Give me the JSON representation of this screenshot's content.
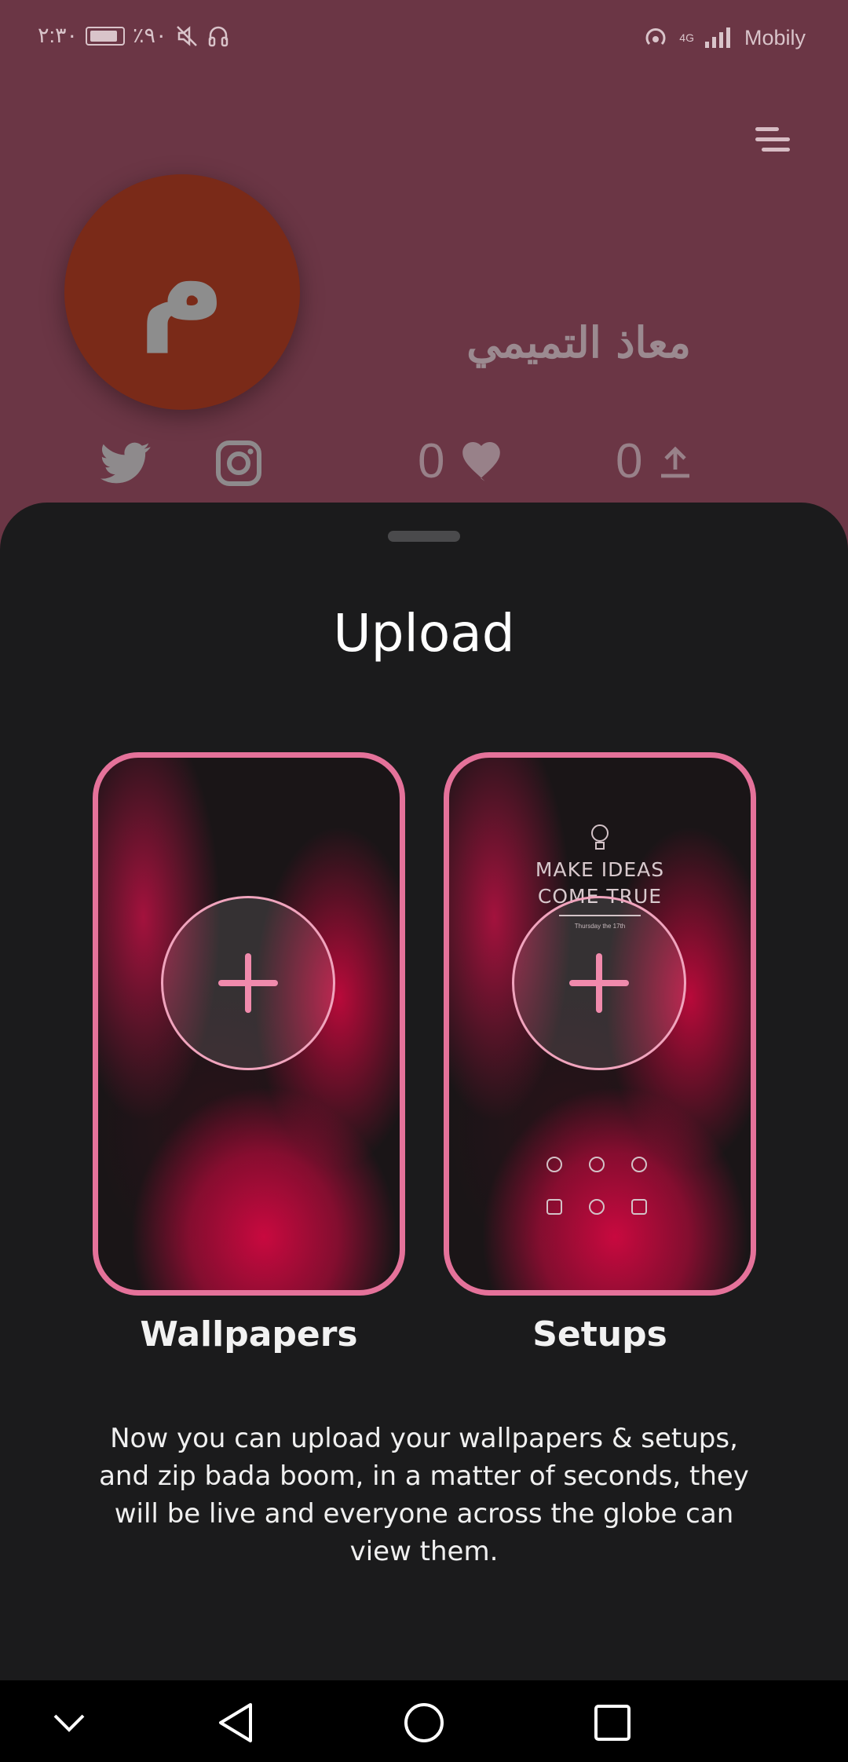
{
  "status_bar": {
    "time": "٢:٣٠",
    "battery": "٪٩٠",
    "carrier": "Mobily",
    "network": "4G"
  },
  "profile": {
    "avatar_letter": "م",
    "name": "معاذ التميمي",
    "likes_count": "0",
    "uploads_count": "0",
    "social_links": [
      "twitter-icon",
      "instagram-icon"
    ]
  },
  "sheet": {
    "title": "Upload",
    "cards": [
      {
        "label": "Wallpapers"
      },
      {
        "label": "Setups",
        "preview_line1": "MAKE IDEAS",
        "preview_line2": "COME TRUE",
        "preview_date": "Thursday the 17th"
      }
    ],
    "description": "Now you can upload your wallpapers & setups, and zip bada boom, in a matter of seconds, they will be live and everyone across the globe can view them."
  },
  "colors": {
    "accent": "#e5729a",
    "sheet_bg": "#1b1b1c",
    "profile_bg": "#6b3645"
  }
}
